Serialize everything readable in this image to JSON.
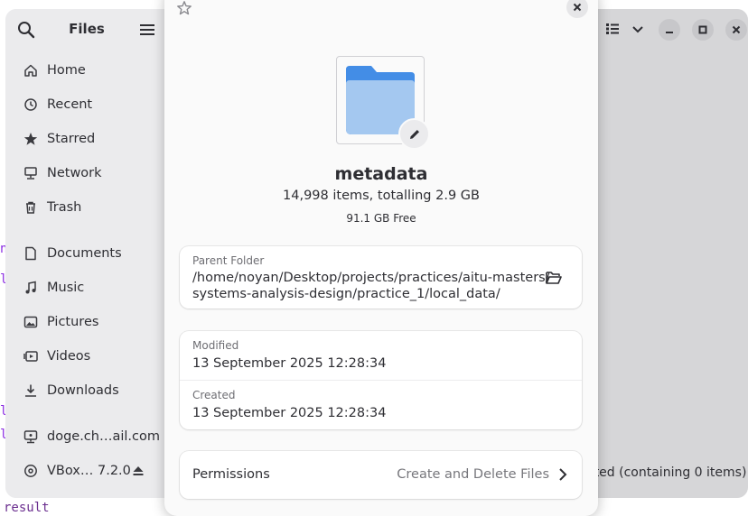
{
  "sidebar": {
    "title": "Files",
    "places": [
      {
        "label": "Home",
        "icon": "home-icon"
      },
      {
        "label": "Recent",
        "icon": "clock-icon"
      },
      {
        "label": "Starred",
        "icon": "star-icon"
      },
      {
        "label": "Network",
        "icon": "network-icon"
      },
      {
        "label": "Trash",
        "icon": "trash-icon"
      }
    ],
    "bookmarks": [
      {
        "label": "Documents",
        "icon": "document-icon"
      },
      {
        "label": "Music",
        "icon": "music-icon"
      },
      {
        "label": "Pictures",
        "icon": "picture-icon"
      },
      {
        "label": "Videos",
        "icon": "video-icon"
      },
      {
        "label": "Downloads",
        "icon": "download-icon"
      }
    ],
    "devices": [
      {
        "label": "doge.ch…ail.com",
        "icon": "online-account-icon"
      },
      {
        "label": "VBox… 7.2.0",
        "icon": "disc-icon"
      }
    ]
  },
  "main": {
    "status": "cted  (containing 0 items)"
  },
  "background": {
    "result_text": "result"
  },
  "dialog": {
    "name": "metadata",
    "summary": "14,998 items, totalling 2.9 GB",
    "free": "91.1 GB Free",
    "parent_folder": {
      "caption": "Parent Folder",
      "line1": "/home/noyan/Desktop/projects/practices/aitu-masters/",
      "line2": "systems-analysis-design/practice_1/local_data/"
    },
    "modified": {
      "caption": "Modified",
      "value": "13 September 2025 12:28:34"
    },
    "created": {
      "caption": "Created",
      "value": "13 September 2025 12:28:34"
    },
    "permissions": {
      "label": "Permissions",
      "value": "Create and Delete Files"
    }
  },
  "colors": {
    "folder_light": "#a4c8f0",
    "folder_dark": "#438de6",
    "accent_text": "#2e2e33"
  }
}
